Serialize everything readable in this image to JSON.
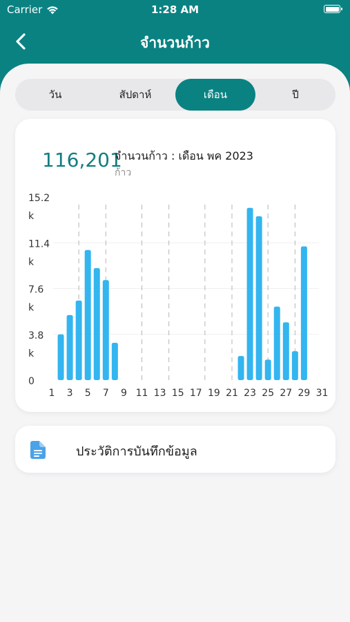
{
  "status_bar": {
    "carrier": "Carrier",
    "time": "1:28 AM"
  },
  "nav": {
    "title": "จำนวนก้าว",
    "back_icon": "chevron-left-icon"
  },
  "tabs": [
    {
      "label": "วัน",
      "active": false
    },
    {
      "label": "สัปดาห์",
      "active": false
    },
    {
      "label": "เดือน",
      "active": true
    },
    {
      "label": "ปี",
      "active": false
    }
  ],
  "summary": {
    "total": "116,201",
    "caption": "จำนวนก้าว : เดือน พค 2023",
    "unit": "ก้าว"
  },
  "chart_data": {
    "type": "bar",
    "ytick_labels": [
      {
        "value": 15.2,
        "lines": [
          "15.2",
          "k"
        ]
      },
      {
        "value": 11.4,
        "lines": [
          "11.4",
          "k"
        ]
      },
      {
        "value": 7.6,
        "lines": [
          "7.6",
          "k"
        ]
      },
      {
        "value": 3.8,
        "lines": [
          "3.8",
          "k"
        ]
      },
      {
        "value": 0,
        "lines": [
          "0"
        ]
      }
    ],
    "xtick_labels": [
      "1",
      "3",
      "5",
      "7",
      "9",
      "11",
      "13",
      "15",
      "17",
      "19",
      "21",
      "23",
      "25",
      "27",
      "29",
      "31"
    ],
    "ylim": [
      0,
      15.2
    ],
    "bar_color": "#33b5f0",
    "days": [
      1,
      2,
      3,
      4,
      5,
      6,
      7,
      8,
      9,
      10,
      11,
      12,
      13,
      14,
      15,
      16,
      17,
      18,
      19,
      20,
      21,
      22,
      23,
      24,
      25,
      26,
      27,
      28,
      29,
      30,
      31
    ],
    "values": [
      0,
      3.8,
      5.4,
      6.6,
      10.8,
      9.3,
      8.3,
      3.1,
      0,
      0,
      0,
      0,
      0,
      0,
      0,
      0,
      0,
      0,
      0,
      0,
      0,
      2.0,
      14.3,
      13.6,
      1.7,
      6.1,
      4.8,
      2.4,
      11.1,
      0,
      0
    ],
    "week_divider_days": [
      4,
      7,
      11,
      14,
      18,
      21,
      25,
      28
    ]
  },
  "history": {
    "label": "ประวัติการบันทึกข้อมูล",
    "icon": "document-icon"
  },
  "colors": {
    "primary": "#0a8282",
    "bar": "#33b5f0",
    "background": "#f5f5f6"
  }
}
